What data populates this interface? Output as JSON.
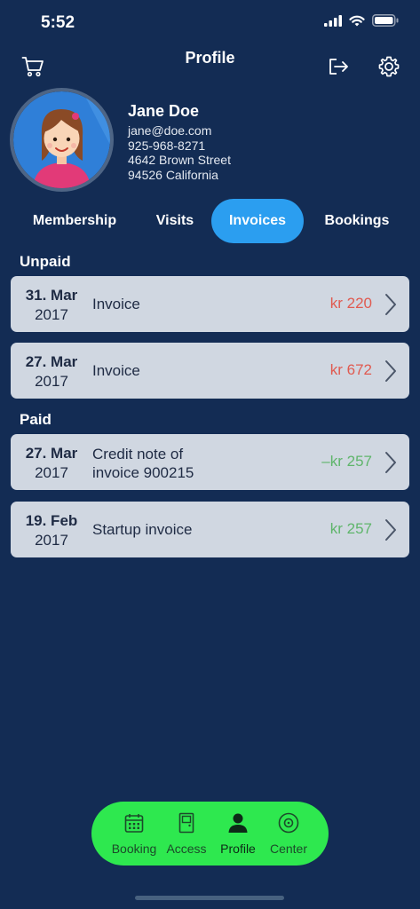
{
  "status_bar": {
    "time": "5:52"
  },
  "header": {
    "title": "Profile"
  },
  "profile": {
    "name": "Jane Doe",
    "email": "jane@doe.com",
    "phone": "925-968-8271",
    "street": "4642 Brown Street",
    "city": "94526 California"
  },
  "tabs": [
    {
      "label": "Membership"
    },
    {
      "label": "Visits"
    },
    {
      "label": "Invoices",
      "active": true
    },
    {
      "label": "Bookings"
    }
  ],
  "sections": {
    "unpaid": {
      "title": "Unpaid",
      "items": [
        {
          "day": "31. Mar",
          "year": "2017",
          "description": "Invoice",
          "amount": "kr 220"
        },
        {
          "day": "27. Mar",
          "year": "2017",
          "description": "Invoice",
          "amount": "kr 672"
        }
      ]
    },
    "paid": {
      "title": "Paid",
      "items": [
        {
          "day": "27. Mar",
          "year": "2017",
          "description_line1": "Credit note of",
          "description_line2": "invoice 900215",
          "amount": "–kr 257"
        },
        {
          "day": "19. Feb",
          "year": "2017",
          "description": "Startup invoice",
          "amount": "kr 257"
        }
      ]
    }
  },
  "bottom_nav": [
    {
      "label": "Booking",
      "icon": "calendar-icon"
    },
    {
      "label": "Access",
      "icon": "door-icon"
    },
    {
      "label": "Profile",
      "icon": "person-icon",
      "active": true
    },
    {
      "label": "Center",
      "icon": "target-icon"
    }
  ],
  "colors": {
    "background": "#132c54",
    "active_tab": "#2b9ef0",
    "card": "#d0d7e1",
    "amount_unpaid": "#e05a50",
    "amount_paid": "#5fb56b",
    "nav_bar": "#2ee84f"
  }
}
